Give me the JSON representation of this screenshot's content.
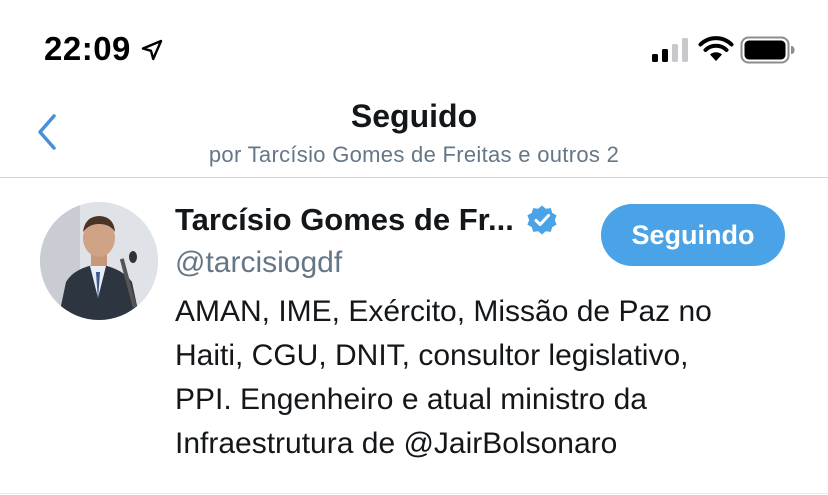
{
  "status_bar": {
    "time": "22:09",
    "location_icon": "location-arrow-icon",
    "signal_icon": "cellular-signal-icon",
    "wifi_icon": "wifi-icon",
    "battery_icon": "battery-icon"
  },
  "nav": {
    "back_icon": "chevron-left-icon",
    "title": "Seguido",
    "subtitle": "por Tarcísio Gomes de Freitas e outros 2"
  },
  "user": {
    "name": "Tarcísio Gomes de Fr...",
    "handle": "@tarcisiogdf",
    "verified_icon": "verified-badge-icon",
    "follow_button_label": "Seguindo",
    "bio_lines": [
      "AMAN, IME, Exército, Missão de Paz no",
      "Haiti, CGU, DNIT, consultor legislativo,",
      "PPI. Engenheiro e atual ministro da",
      "Infraestrutura de @JairBolsonaro"
    ]
  },
  "colors": {
    "accent": "#4aa3e6",
    "back_chevron": "#4a90d9",
    "secondary_text": "#657786",
    "primary_text": "#14171a"
  }
}
